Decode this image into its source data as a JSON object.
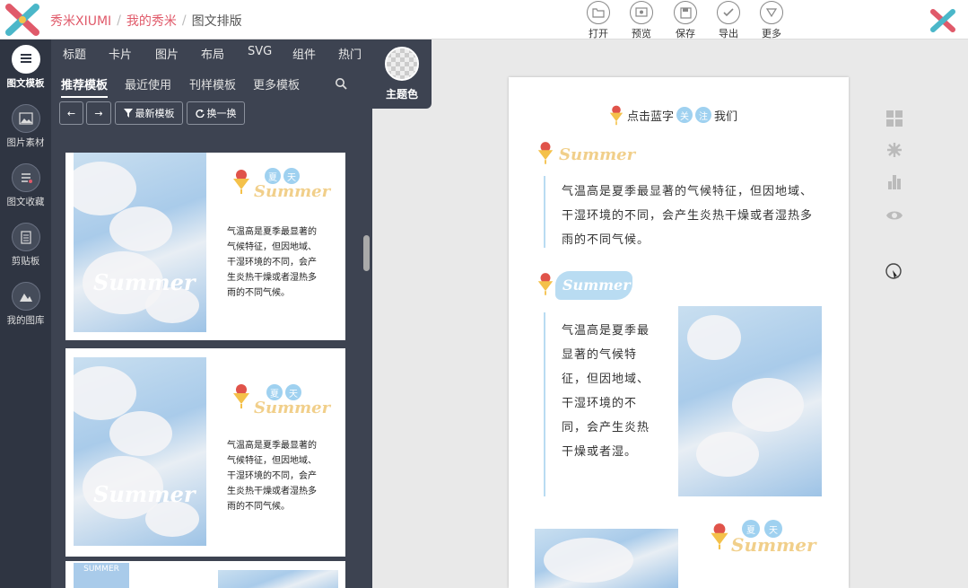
{
  "header": {
    "brand": "秀米XIUMI",
    "breadcrumb": [
      "我的秀米",
      "图文排版"
    ],
    "tools": [
      {
        "label": "打开",
        "icon": "folder-icon"
      },
      {
        "label": "预览",
        "icon": "preview-icon"
      },
      {
        "label": "保存",
        "icon": "save-icon"
      },
      {
        "label": "导出",
        "icon": "check-icon"
      },
      {
        "label": "更多",
        "icon": "more-icon"
      }
    ]
  },
  "rail": [
    {
      "label": "图文模板",
      "icon": "template-icon"
    },
    {
      "label": "图片素材",
      "icon": "image-icon"
    },
    {
      "label": "图文收藏",
      "icon": "favorite-icon"
    },
    {
      "label": "剪贴板",
      "icon": "clipboard-icon"
    },
    {
      "label": "我的图库",
      "icon": "gallery-icon"
    }
  ],
  "category_tabs": [
    "标题",
    "卡片",
    "图片",
    "布局",
    "SVG",
    "组件",
    "热门"
  ],
  "sub_tabs": [
    "推荐模板",
    "最近使用",
    "刊样模板",
    "更多模板"
  ],
  "buttons": {
    "prev": "←",
    "next": "→",
    "newest": "最新模板",
    "refresh": "换一换"
  },
  "theme": {
    "label": "主题色"
  },
  "template_cards": [
    {
      "badge1": "夏",
      "badge2": "天",
      "title": "Summer",
      "photo_text": "Summer",
      "text": "气温高是夏季最显著的气候特征，但因地域、干湿环境的不同，会产生炎热干燥或者湿热多雨的不同气候。"
    },
    {
      "badge1": "夏",
      "badge2": "天",
      "title": "Summer",
      "photo_text": "Summer",
      "text": "气温高是夏季最显著的气候特征，但因地域、干湿环境的不同，会产生炎热干燥或者湿热多雨的不同气候。"
    },
    {
      "corner": "SUMMER"
    }
  ],
  "canvas": {
    "follow_pre": "点击蓝字",
    "follow_badge1": "关",
    "follow_badge2": "注",
    "follow_post": "我们",
    "heading1": "Summer",
    "para1": "气温高是夏季最显著的气候特征，但因地域、干湿环境的不同，会产生炎热干燥或者湿热多雨的不同气候。",
    "heading2": "Summer",
    "para2": "气温高是夏季最显著的气候特征，但因地域、干湿环境的不同，会产生炎热干燥或者湿。",
    "badge1": "夏",
    "badge2": "天",
    "heading3": "Summer"
  },
  "colors": {
    "accent": "#e05a6a",
    "panel": "#3d4351",
    "rail": "#2f3542",
    "sky": "#a9cbea",
    "summer_gold": "#f1cf8a",
    "badge": "#9fd1f0"
  }
}
